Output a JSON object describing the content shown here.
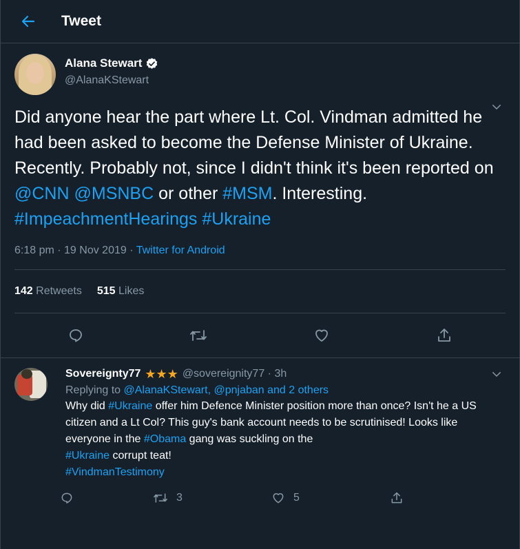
{
  "header": {
    "title": "Tweet",
    "back_icon": "arrow-left-icon"
  },
  "tweet": {
    "author_name": "Alana Stewart",
    "author_handle": "@AlanaKStewart",
    "verified_icon": "verified-badge-icon",
    "text_parts": {
      "p1": "Did anyone hear the part where Lt. Col. Vindman admitted he had been asked to become the Defense Minister of Ukraine. Recently. Probably not, since I didn't think it's been reported on ",
      "mention_cnn": "@CNN",
      "sp1": " ",
      "mention_msnbc": "@MSNBC",
      "p2": " or other ",
      "hashtag_msm": "#MSM",
      "p3": ". Interesting. ",
      "hashtag_impeach": "#ImpeachmentHearings",
      "sp2": " ",
      "hashtag_ukraine": "#Ukraine"
    },
    "timestamp": "6:18 pm · 19 Nov 2019 · ",
    "source": "Twitter for Android",
    "retweets_count": "142",
    "retweets_label": "Retweets",
    "likes_count": "515",
    "likes_label": "Likes"
  },
  "reply": {
    "author_name": "Sovereignty77",
    "stars": "★★★",
    "author_handle": "@sovereignity77 · 3h",
    "replying_prefix": "Replying to ",
    "replying_to": "@AlanaKStewart, @pnjaban and 2 others",
    "text_parts": {
      "a1": "Why did ",
      "h_ukraine1": "#Ukraine",
      "a2": " offer him Defence Minister position more than once? Isn't he a US citizen and a Lt Col? This guy's bank account needs to be scrutinised! Looks like everyone in the ",
      "h_obama": "#Obama",
      "a3": " gang was suckling on the ",
      "h_ukraine2": "#Ukraine",
      "a4": " corrupt teat!",
      "h_vindman": "#VindmanTestimony"
    },
    "retweet_count": "3",
    "like_count": "5"
  },
  "colors": {
    "background": "#15202b",
    "accent": "#1da1f2",
    "muted": "#8899a6",
    "border": "#38444d",
    "star": "#f5a623"
  }
}
